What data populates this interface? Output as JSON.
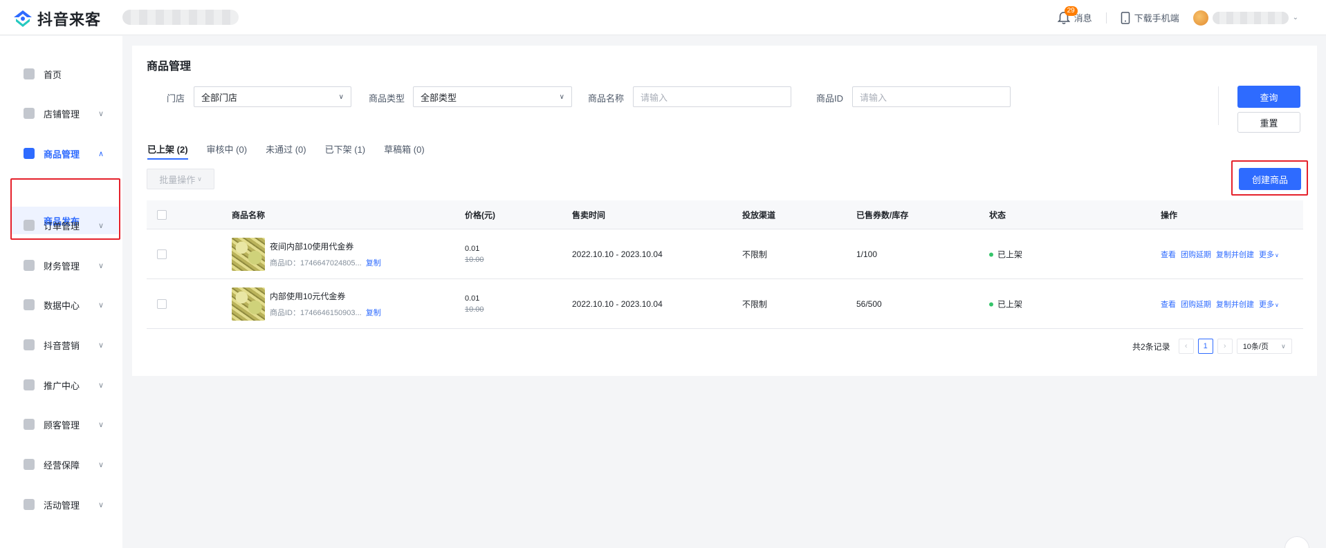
{
  "header": {
    "brand": "抖音来客",
    "notifications_count": "29",
    "notifications_label": "消息",
    "download_label": "下载手机端"
  },
  "sidebar": {
    "items": [
      {
        "label": "首页",
        "icon": "home-icon"
      },
      {
        "label": "店铺管理",
        "icon": "store-icon"
      },
      {
        "label": "商品管理",
        "icon": "goods-icon",
        "active": true
      },
      {
        "label": "订单管理",
        "icon": "order-icon"
      },
      {
        "label": "财务管理",
        "icon": "finance-icon"
      },
      {
        "label": "数据中心",
        "icon": "data-icon"
      },
      {
        "label": "抖音营销",
        "icon": "marketing-icon"
      },
      {
        "label": "推广中心",
        "icon": "promotion-icon"
      },
      {
        "label": "顾客管理",
        "icon": "customer-icon"
      },
      {
        "label": "经营保障",
        "icon": "shield-icon"
      },
      {
        "label": "活动管理",
        "icon": "activity-icon"
      }
    ],
    "subitem": "商品发布"
  },
  "page": {
    "title": "商品管理"
  },
  "filters": {
    "store_label": "门店",
    "store_value": "全部门店",
    "type_label": "商品类型",
    "type_value": "全部类型",
    "name_label": "商品名称",
    "name_placeholder": "请输入",
    "id_label": "商品ID",
    "id_placeholder": "请输入",
    "search_button": "查询",
    "reset_button": "重置"
  },
  "tabs": [
    {
      "label": "已上架",
      "count": "(2)",
      "active": true
    },
    {
      "label": "审核中",
      "count": "(0)"
    },
    {
      "label": "未通过",
      "count": "(0)"
    },
    {
      "label": "已下架",
      "count": "(1)"
    },
    {
      "label": "草稿箱",
      "count": "(0)"
    }
  ],
  "toolbar": {
    "batch_label": "批量操作",
    "create_button": "创建商品"
  },
  "table": {
    "columns": [
      "商品名称",
      "价格(元)",
      "售卖时间",
      "投放渠道",
      "已售券数/库存",
      "状态",
      "操作"
    ],
    "rows": [
      {
        "name": "夜间内部10使用代金券",
        "id_text": "商品ID：1746647024805...",
        "copy": "复制",
        "price": "0.01",
        "orig_price": "10.00",
        "period": "2022.10.10 - 2023.10.04",
        "channel": "不限制",
        "sold_stock": "1/100",
        "status": "已上架",
        "ops": [
          "查看",
          "团购延期",
          "复制并创建",
          "更多"
        ]
      },
      {
        "name": "内部使用10元代金券",
        "id_text": "商品ID：1746646150903...",
        "copy": "复制",
        "price": "0.01",
        "orig_price": "10.00",
        "period": "2022.10.10 - 2023.10.04",
        "channel": "不限制",
        "sold_stock": "56/500",
        "status": "已上架",
        "ops": [
          "查看",
          "团购延期",
          "复制并创建",
          "更多"
        ]
      }
    ]
  },
  "pagination": {
    "total_text": "共2条记录",
    "current_page": "1",
    "page_size": "10条/页"
  },
  "colors": {
    "primary": "#2e6bff",
    "highlight_border": "#e5202a",
    "status_online": "#35c46a",
    "badge": "#ff7d00"
  }
}
